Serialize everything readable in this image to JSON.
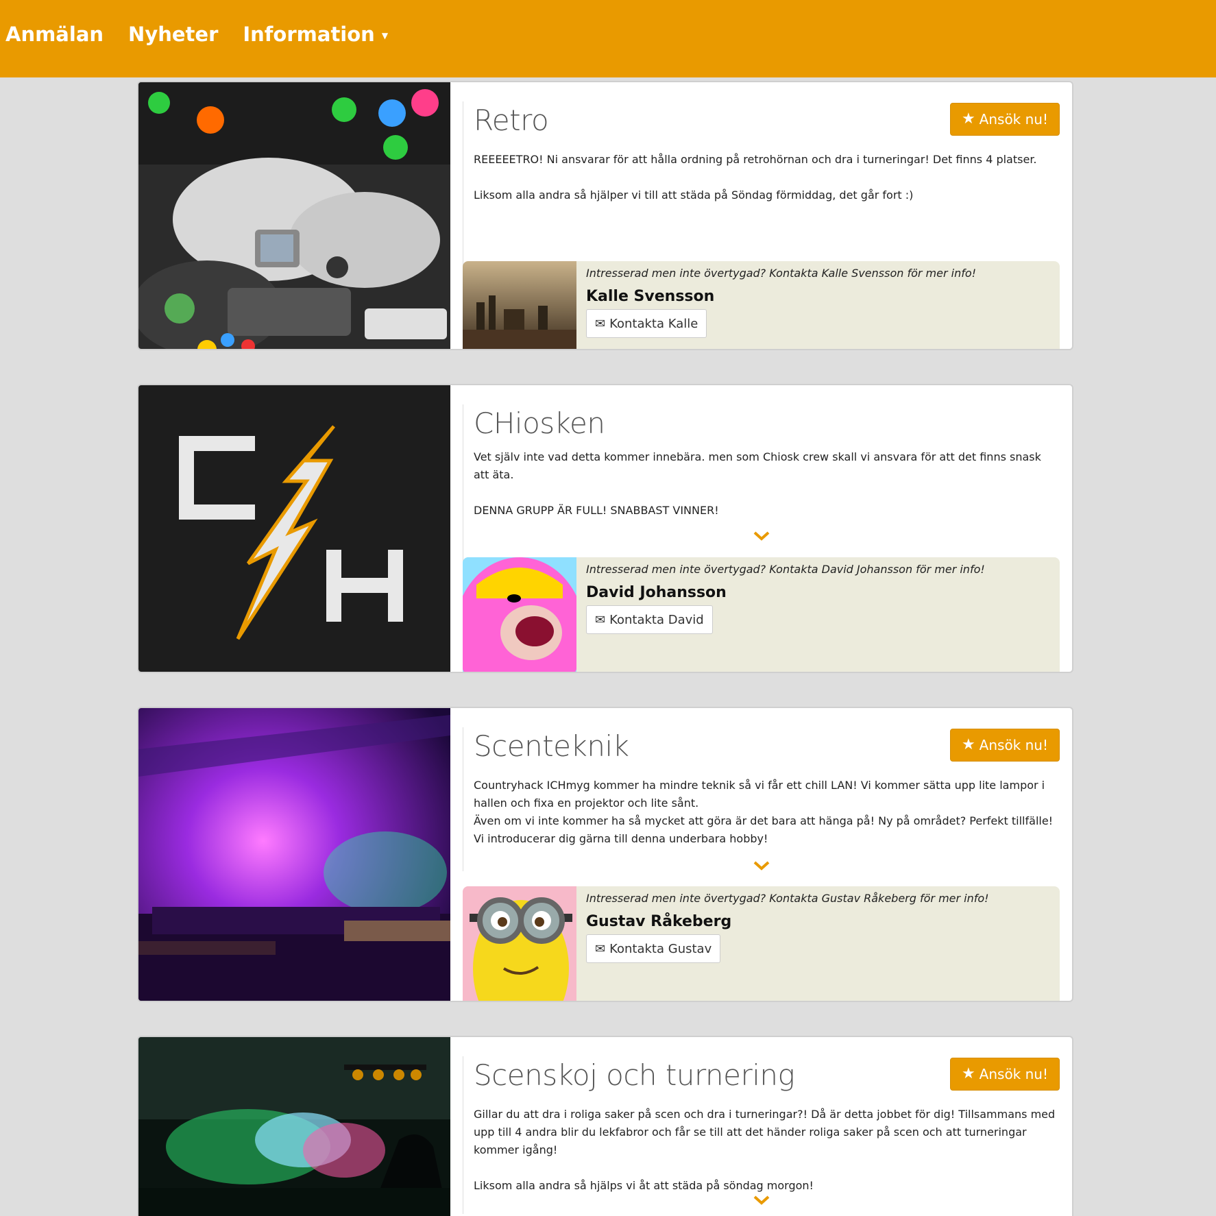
{
  "nav": {
    "items": [
      "Anmälan",
      "Nyheter",
      "Information"
    ]
  },
  "cards": [
    {
      "title": "Retro",
      "apply": "Ansök nu!",
      "desc": "REEEEETRO! Ni ansvarar för att hålla ordning på retrohörnan och dra i turneringar! Det finns 4 platser.\n\nLiksom alla andra så hjälper vi till att städa på Söndag förmiddag, det går fort :)",
      "contact_intro": "Intresserad men inte övertygad? Kontakta Kalle Svensson för mer info!",
      "contact_name": "Kalle Svensson",
      "contact_button": "Kontakta Kalle"
    },
    {
      "title": "CHiosken",
      "desc": "Vet själv inte vad detta kommer innebära. men som Chiosk crew skall vi ansvara för att det finns snask att äta.\n\nDENNA GRUPP ÄR FULL! SNABBAST VINNER!",
      "contact_intro": "Intresserad men inte övertygad? Kontakta David Johansson för mer info!",
      "contact_name": "David Johansson",
      "contact_button": "Kontakta David"
    },
    {
      "title": "Scenteknik",
      "apply": "Ansök nu!",
      "desc": "Countryhack ICHmyg kommer ha mindre teknik så vi får ett chill LAN! Vi kommer sätta upp lite lampor i hallen och fixa en projektor och lite sånt.\nÄven om vi inte kommer ha så mycket att göra är det bara att hänga på! Ny på området? Perfekt tillfälle! Vi introducerar dig gärna till denna underbara hobby!",
      "contact_intro": "Intresserad men inte övertygad? Kontakta Gustav Råkeberg för mer info!",
      "contact_name": "Gustav Råkeberg",
      "contact_button": "Kontakta Gustav"
    },
    {
      "title": "Scenskoj och turnering",
      "apply": "Ansök nu!",
      "desc": "Gillar du att dra i roliga saker på scen och dra i turneringar?! Då är detta jobbet för dig! Tillsammans med upp till 4 andra blir du lekfabror och får se till att det händer roliga saker på scen och att turneringar kommer igång!\n\nLiksom alla andra så hjälps vi åt att städa på söndag morgon!"
    }
  ],
  "icons": {
    "star": "star-icon",
    "chevron": "chevron-down-icon",
    "mail": "envelope-icon",
    "caret": "caret-down-icon"
  },
  "colors": {
    "accent": "#e99a00",
    "contact_bg": "#ecebdc",
    "page_bg": "#dedede"
  }
}
